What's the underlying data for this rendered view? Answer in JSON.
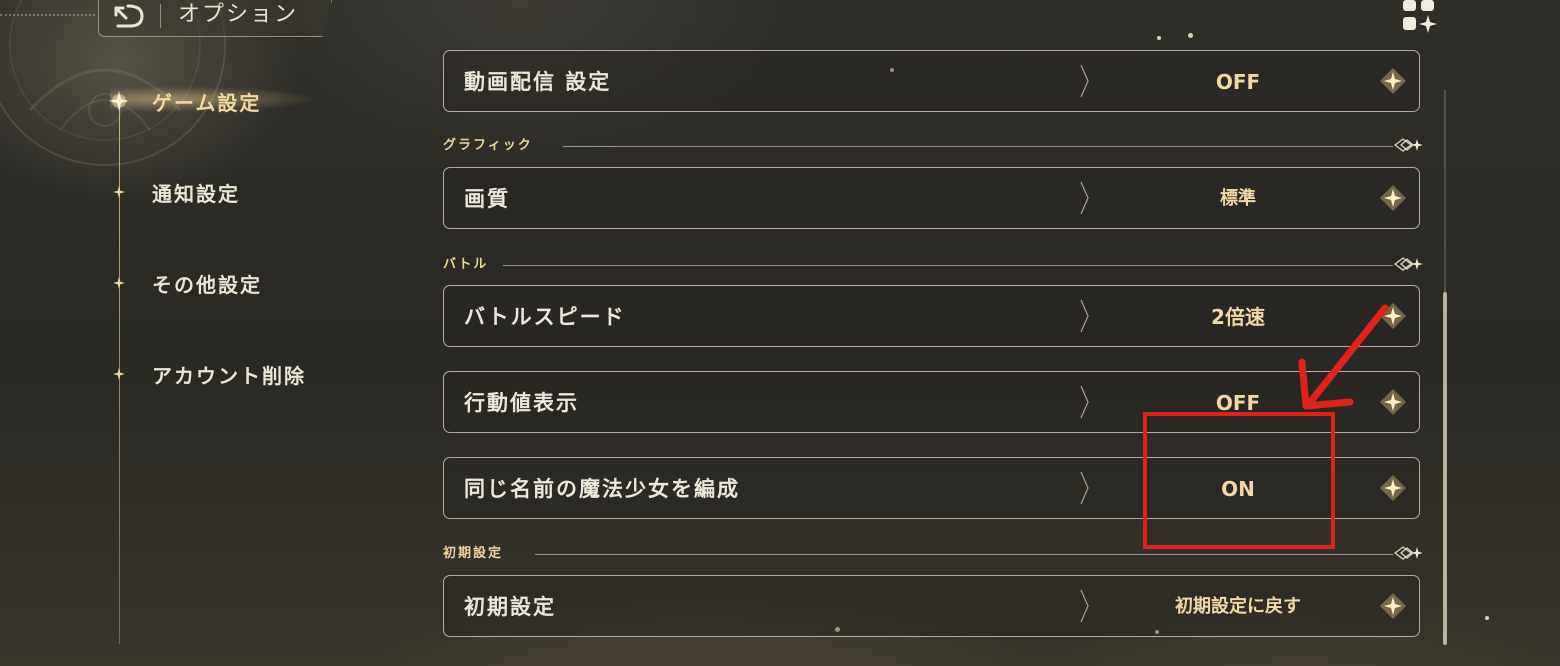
{
  "header": {
    "title": "オプション",
    "back_icon": "back-return-icon",
    "menu_icon": "grid-menu-icon"
  },
  "sidebar": {
    "items": [
      {
        "label": "ゲーム設定",
        "active": true
      },
      {
        "label": "通知設定",
        "active": false
      },
      {
        "label": "その他設定",
        "active": false
      },
      {
        "label": "アカウント削除",
        "active": false
      }
    ]
  },
  "settings": {
    "streaming": {
      "label": "動画配信 設定",
      "value": "OFF"
    },
    "graphics_section": "グラフィック",
    "quality": {
      "label": "画質",
      "value": "標準"
    },
    "battle_section": "バトル",
    "battle_speed": {
      "label": "バトルスピード",
      "value": "2倍速"
    },
    "action_value": {
      "label": "行動値表示",
      "value": "OFF"
    },
    "same_name": {
      "label": "同じ名前の魔法少女を編成",
      "value": "ON"
    },
    "reset_section": "初期設定",
    "reset": {
      "label": "初期設定",
      "value": "初期設定に戻す"
    }
  },
  "colors": {
    "accent_gold": "#f2d9a4",
    "annotation_red": "#e0221b",
    "row_border": "#e1dac8"
  },
  "icons": {
    "dropdown": "diamond-sparkle-icon",
    "section_end": "ornament-flourish-icon",
    "sidebar_bullet": "star-icon"
  }
}
